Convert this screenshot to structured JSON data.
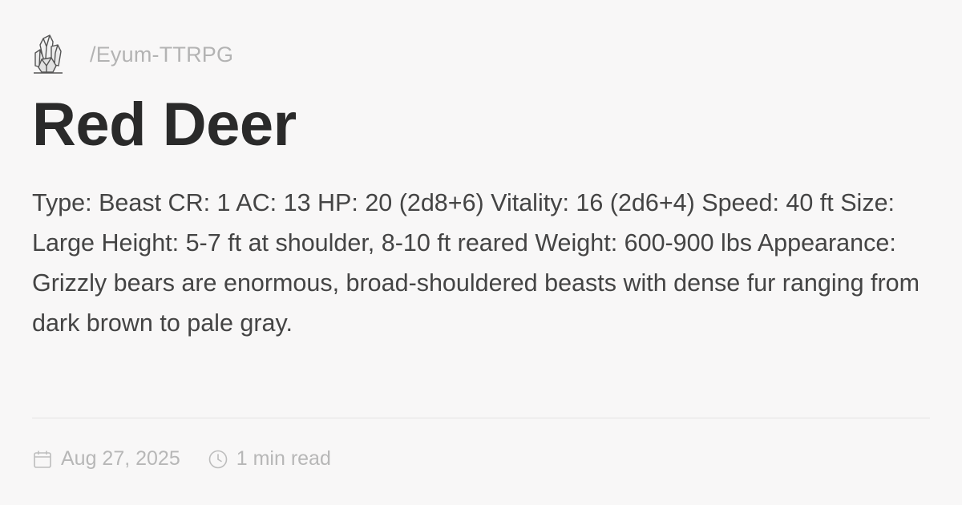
{
  "site": {
    "logo_icon": "crystal-cluster-icon",
    "path": "/Eyum-TTRPG"
  },
  "article": {
    "title": "Red Deer",
    "body": "Type: Beast CR: 1 AC: 13 HP: 20 (2d8+6) Vitality: 16 (2d6+4) Speed: 40 ft Size: Large Height: 5-7 ft at shoulder, 8-10 ft reared Weight: 600-900 lbs Appearance: Grizzly bears are enormous, broad-shouldered beasts with dense fur ranging from dark brown to pale gray."
  },
  "meta": {
    "date_icon": "calendar-icon",
    "date": "Aug 27, 2025",
    "read_icon": "clock-icon",
    "read_time": "1 min read"
  },
  "colors": {
    "background": "#f8f7f7",
    "title": "#2a2a2a",
    "body": "#444444",
    "muted": "#b7b7b7"
  }
}
